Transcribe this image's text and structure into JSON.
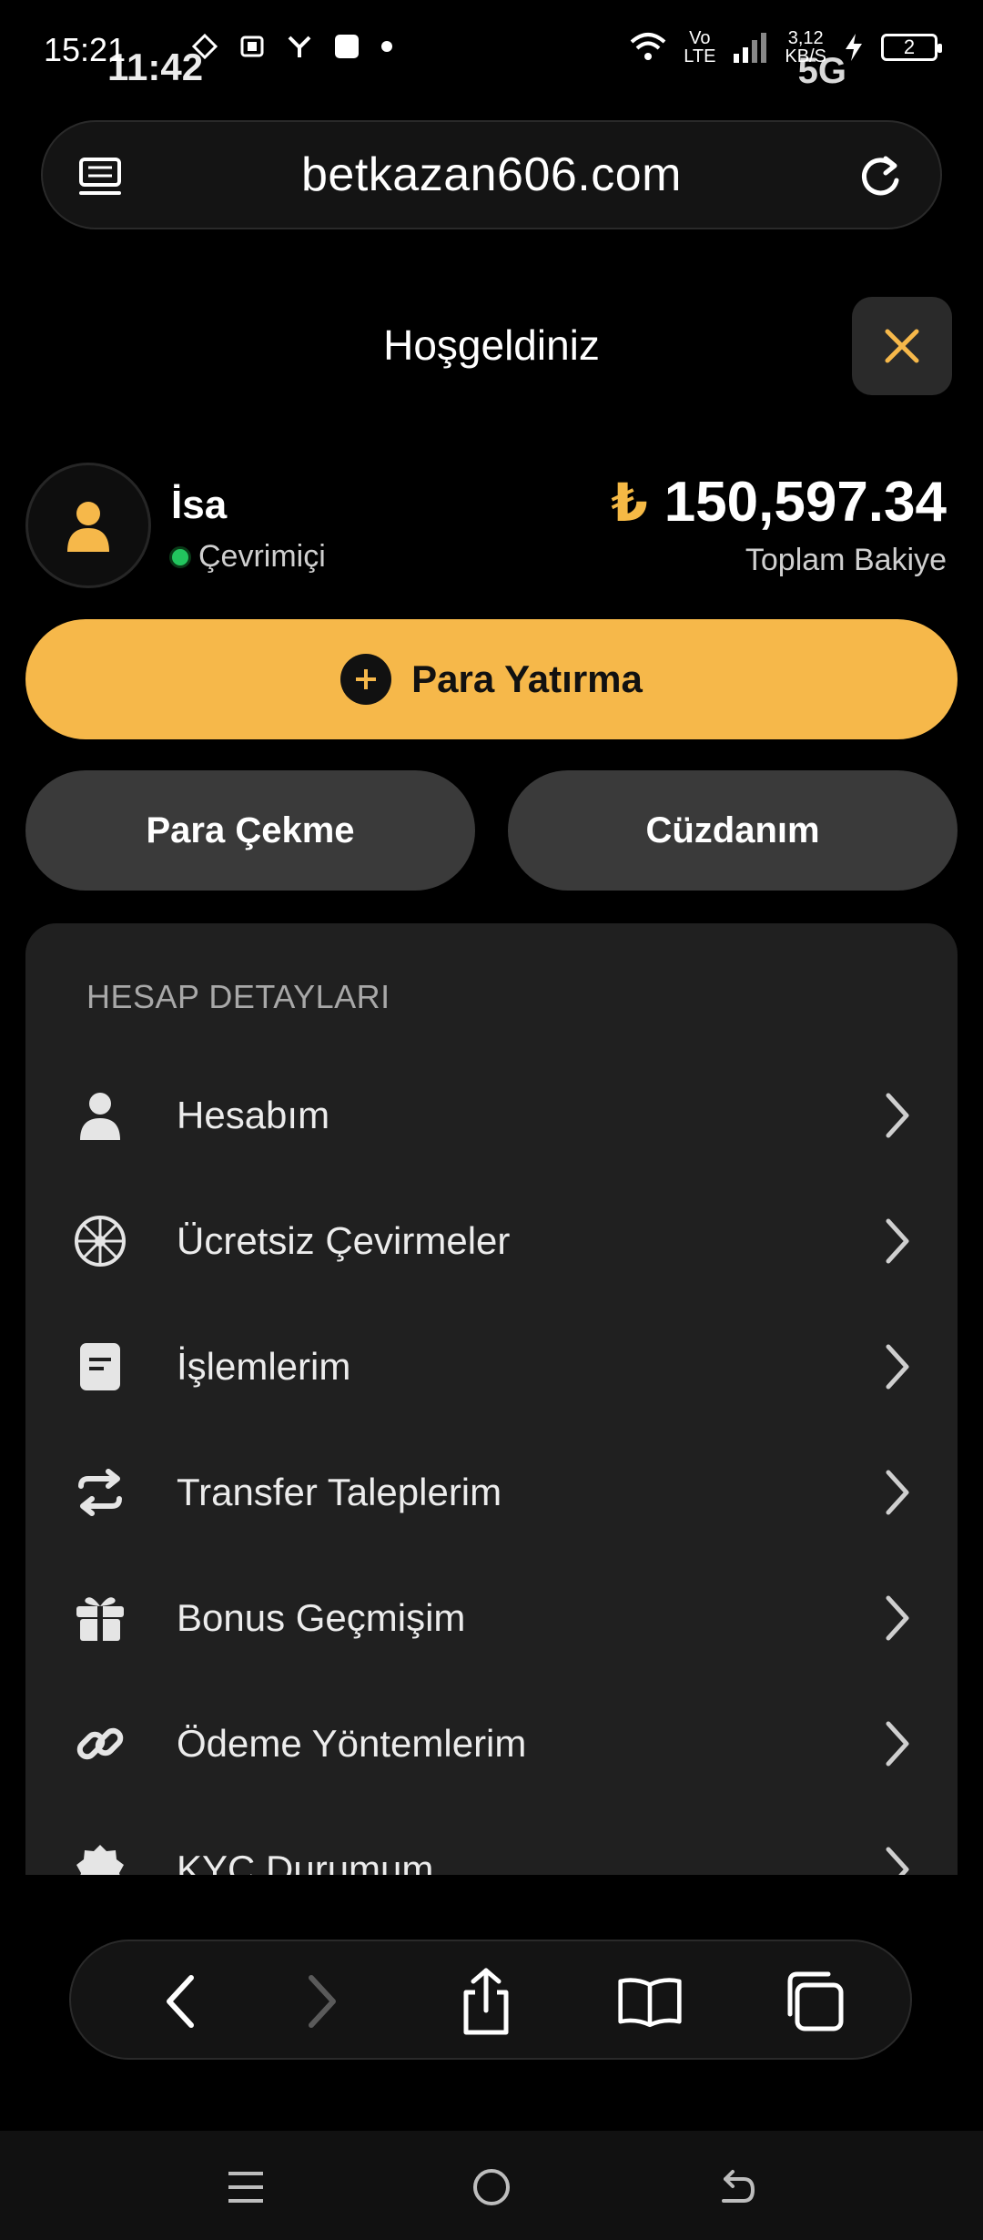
{
  "status_bar": {
    "time_primary": "15:21",
    "time_overlay": "11:42",
    "network_top": "Vo",
    "network_bottom": "LTE",
    "speed_top": "3,12",
    "speed_bottom": "KB/S",
    "network_type": "5G",
    "battery_level": "2"
  },
  "browser": {
    "url": "betkazan606.com"
  },
  "header": {
    "title": "Hoşgeldiniz"
  },
  "profile": {
    "name": "İsa",
    "status": "Çevrimiçi",
    "currency_symbol": "₺",
    "balance": "150,597.34",
    "balance_label": "Toplam Bakiye"
  },
  "actions": {
    "deposit_label": "Para Yatırma",
    "withdraw_label": "Para Çekme",
    "wallet_label": "Cüzdanım"
  },
  "account_section": {
    "title": "HESAP DETAYLARI",
    "items": [
      {
        "label": "Hesabım",
        "icon": "user-icon"
      },
      {
        "label": "Ücretsiz Çevirmeler",
        "icon": "wheel-icon"
      },
      {
        "label": "İşlemlerim",
        "icon": "document-icon"
      },
      {
        "label": "Transfer Taleplerim",
        "icon": "transfer-icon"
      },
      {
        "label": "Bonus Geçmişim",
        "icon": "gift-icon"
      },
      {
        "label": "Ödeme Yöntemlerim",
        "icon": "link-icon"
      },
      {
        "label": "KYC Durumum",
        "icon": "badge-icon"
      }
    ]
  },
  "colors": {
    "accent": "#f6b84a",
    "online": "#22c55e",
    "panel": "#202020",
    "button": "#3a3a3a"
  }
}
